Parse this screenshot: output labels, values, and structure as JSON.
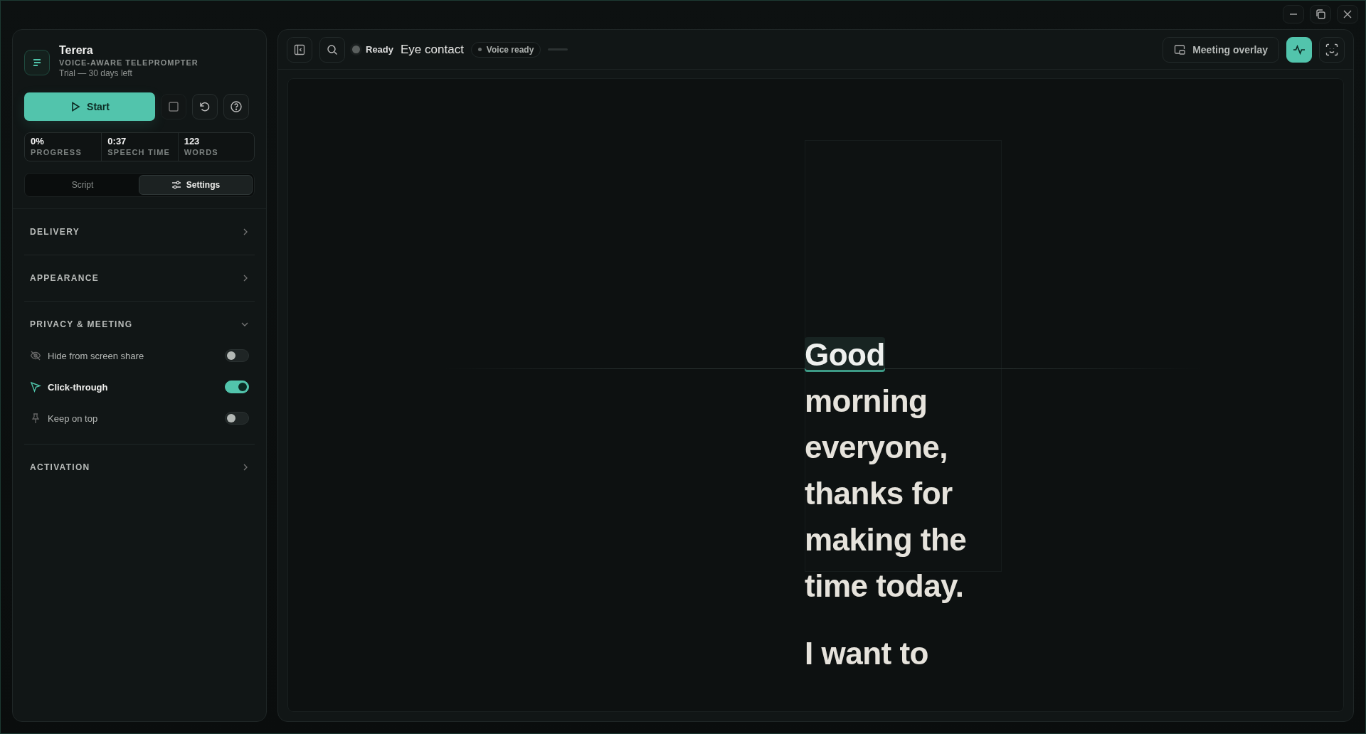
{
  "app": {
    "name": "Terera",
    "subtitle": "VOICE-AWARE TELEPROMPTER",
    "trial": "Trial — 30 days left"
  },
  "controls": {
    "start_label": "Start"
  },
  "stats": [
    {
      "value": "0%",
      "label": "PROGRESS"
    },
    {
      "value": "0:37",
      "label": "SPEECH TIME"
    },
    {
      "value": "123",
      "label": "WORDS"
    }
  ],
  "tabs": [
    {
      "label": "Script",
      "selected": false,
      "kind": "script"
    },
    {
      "label": "Settings",
      "selected": true,
      "kind": "settings"
    }
  ],
  "sections": [
    {
      "title": "DELIVERY",
      "expanded": false
    },
    {
      "title": "APPEARANCE",
      "expanded": false
    },
    {
      "title": "PRIVACY & MEETING",
      "expanded": true,
      "items": [
        {
          "label": "Hide from screen share",
          "kind": "hide",
          "on": false
        },
        {
          "label": "Click-through",
          "kind": "pointer",
          "on": true
        },
        {
          "label": "Keep on top",
          "kind": "pin",
          "on": false
        }
      ]
    },
    {
      "title": "ACTIVATION",
      "expanded": false
    }
  ],
  "toolbar": {
    "status": "Ready",
    "mode": "Eye contact",
    "voice": "Voice ready",
    "meeting_overlay": "Meeting overlay",
    "voice_monitor_active": true
  },
  "script": {
    "paragraphs": [
      [
        {
          "text": "Good",
          "current": true
        },
        {
          "text": "morning",
          "current": false
        },
        {
          "text": "everyone,",
          "current": false
        },
        {
          "text": "thanks",
          "current": false
        },
        {
          "text": "for",
          "current": false
        },
        {
          "text": "making",
          "current": false
        },
        {
          "text": "the",
          "current": false
        },
        {
          "text": "time",
          "current": false
        },
        {
          "text": "today.",
          "current": false
        }
      ],
      [
        {
          "text": "I",
          "current": false
        },
        {
          "text": "want",
          "current": false
        },
        {
          "text": "to",
          "current": false
        }
      ]
    ]
  }
}
